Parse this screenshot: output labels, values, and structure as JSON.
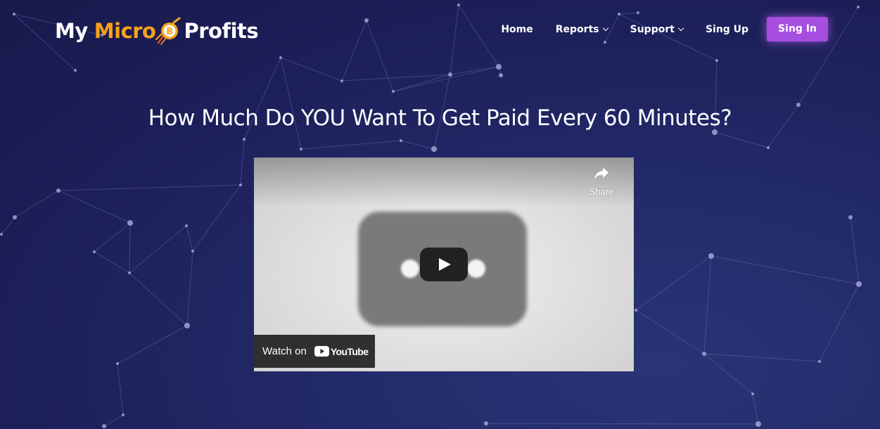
{
  "brand": {
    "word1": "My",
    "word2": "Micro",
    "word3": "Profits",
    "logo_icon": "bitcoin-rocket-coin-icon",
    "colors": {
      "accent": "#f7a21b",
      "text": "#ffffff"
    }
  },
  "nav": {
    "items": [
      {
        "label": "Home",
        "dropdown": false
      },
      {
        "label": "Reports",
        "dropdown": true
      },
      {
        "label": "Support",
        "dropdown": true
      },
      {
        "label": "Sing Up",
        "dropdown": false
      }
    ],
    "cta_label": "Sing In",
    "cta_color": "#a54ee0"
  },
  "hero": {
    "headline": "How Much Do YOU Want To Get Paid Every 60 Minutes?"
  },
  "video": {
    "share_label": "Share",
    "share_icon": "share-arrow-icon",
    "play_icon": "play-icon",
    "watch_on_label": "Watch on",
    "youtube_wordmark": "YouTube"
  },
  "theme": {
    "background": "#1c1f58",
    "network_color": "#7f86c4"
  }
}
